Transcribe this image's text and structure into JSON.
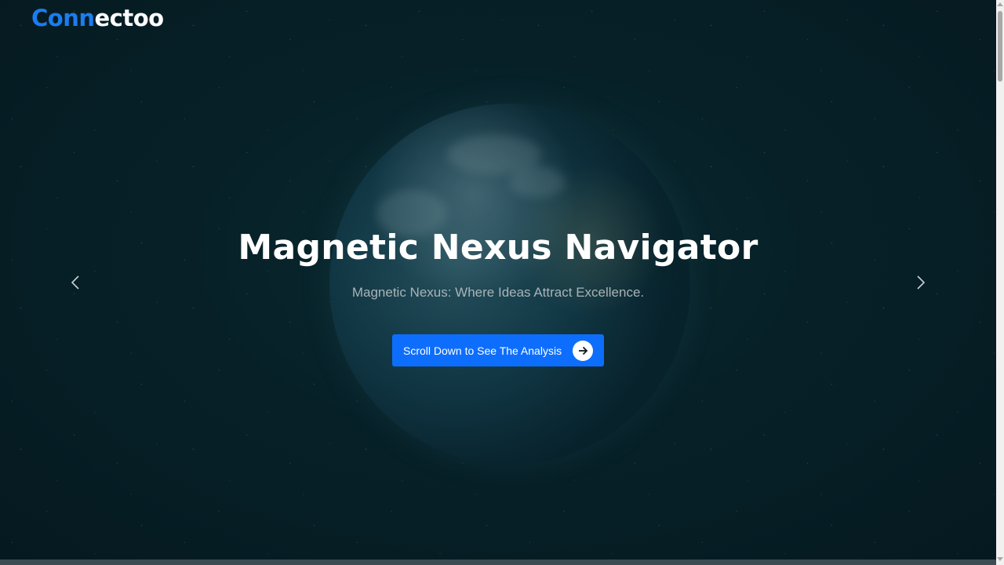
{
  "header": {
    "logo_accent": "Conn",
    "logo_rest": "ectoo"
  },
  "hero": {
    "title": "Magnetic Nexus Navigator",
    "subtitle": "Magnetic Nexus: Where Ideas Attract Excellence.",
    "cta_label": "Scroll Down to See The Analysis",
    "cta_icon": "arrow-right-icon"
  },
  "carousel": {
    "prev_icon": "chevron-left-icon",
    "next_icon": "chevron-right-icon"
  },
  "colors": {
    "brand": "#1a7df0",
    "button": "#0d6efd",
    "background": "#06191f"
  }
}
